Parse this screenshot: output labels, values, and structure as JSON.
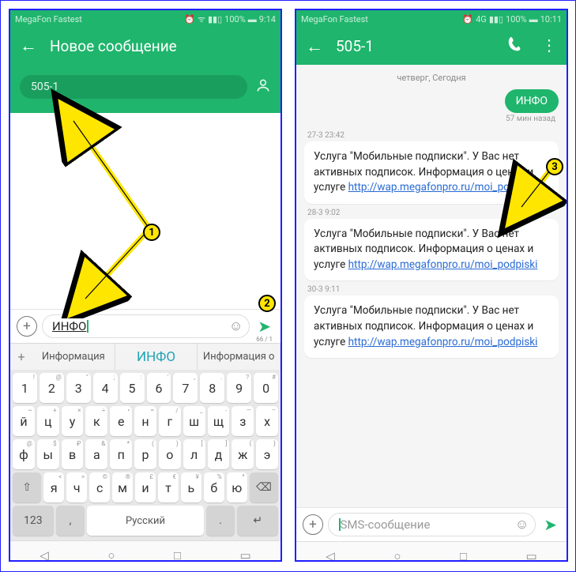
{
  "left": {
    "status": {
      "carrier": "MegaFon Fastest",
      "battery": "100%",
      "time": "9:14"
    },
    "header": {
      "title": "Новое сообщение",
      "recipient": "505-1"
    },
    "input": {
      "value": "ИНФО",
      "counter": "66 / 1"
    },
    "suggestions": {
      "plus": "+",
      "s1": "Информация",
      "s2": "ИНФО",
      "s3": "Информация о"
    },
    "keyboard": {
      "row1": [
        {
          "k": "1",
          "s": "!"
        },
        {
          "k": "2",
          "s": "@"
        },
        {
          "k": "3",
          "s": "\""
        },
        {
          "k": "4",
          "s": ";"
        },
        {
          "k": "5",
          "s": ":"
        },
        {
          "k": "6",
          "s": "'"
        },
        {
          "k": "7",
          "s": ","
        },
        {
          "k": "8",
          "s": "."
        },
        {
          "k": "9",
          "s": "?"
        },
        {
          "k": "0",
          "s": "#"
        }
      ],
      "row2": [
        {
          "k": "й",
          "s": "~"
        },
        {
          "k": "ц",
          "s": "+"
        },
        {
          "k": "у",
          "s": "×"
        },
        {
          "k": "к",
          "s": "÷"
        },
        {
          "k": "е",
          "s": "•"
        },
        {
          "k": "н",
          "s": "="
        },
        {
          "k": "г",
          "s": "/"
        },
        {
          "k": "ш",
          "s": "_"
        },
        {
          "k": "щ",
          "s": "-"
        },
        {
          "k": "з",
          "s": "—"
        },
        {
          "k": "х",
          "s": "–"
        }
      ],
      "row3": [
        {
          "k": "ф",
          "s": "@"
        },
        {
          "k": "ы",
          "s": "$"
        },
        {
          "k": "в",
          "s": "₽"
        },
        {
          "k": "а",
          "s": "&"
        },
        {
          "k": "п",
          "s": "*"
        },
        {
          "k": "р",
          "s": "("
        },
        {
          "k": "о",
          "s": ")"
        },
        {
          "k": "л",
          "s": "["
        },
        {
          "k": "д",
          "s": "]"
        },
        {
          "k": "ж",
          "s": "{"
        },
        {
          "k": "э",
          "s": "}"
        }
      ],
      "row4": [
        {
          "k": "я",
          "s": "<"
        },
        {
          "k": "ч",
          "s": ">"
        },
        {
          "k": "с",
          "s": "©"
        },
        {
          "k": "м",
          "s": "®"
        },
        {
          "k": "и",
          "s": "£"
        },
        {
          "k": "т",
          "s": "€"
        },
        {
          "k": "ь",
          "s": "¥"
        },
        {
          "k": "б",
          "s": "%"
        },
        {
          "k": "ю",
          "s": "^"
        }
      ],
      "shift": "⇧",
      "backspace": "⌫",
      "numkey": "123",
      "comma": ",",
      "space": "Русский",
      "dot": ".",
      "enter": "↵"
    },
    "markers": {
      "m1": "1",
      "m2": "2"
    }
  },
  "right": {
    "status": {
      "carrier": "MegaFon Fastest",
      "battery": "100%",
      "time": "10:11"
    },
    "header": {
      "title": "505-1"
    },
    "chat": {
      "date": "четверг, Сегодня",
      "out": {
        "text": "ИНФО",
        "time": "57 мин назад"
      },
      "msgs": [
        {
          "time": "27-3 23:42",
          "text": "Услуга \"Мобильные подписки\". У Вас нет активных подписок. Информация о ценах и услуге ",
          "link": "http://wap.megafonpro.ru/moi_podpiski"
        },
        {
          "time": "28-3 9:02",
          "text": "Услуга \"Мобильные подписки\". У Вас нет активных подписок. Информация о ценах и услуге ",
          "link": "http://wap.megafonpro.ru/moi_podpiski"
        },
        {
          "time": "30-3 9:11",
          "text": "Услуга \"Мобильные подписки\". У Вас нет активных подписок. Информация о ценах и услуге ",
          "link": "http://wap.megafonpro.ru/moi_podpiski"
        }
      ]
    },
    "input": {
      "placeholder": "SMS-сообщение"
    },
    "markers": {
      "m3": "3"
    }
  },
  "nav": {
    "back": "◁",
    "home": "○",
    "recent": "□",
    "extra": "▭"
  }
}
